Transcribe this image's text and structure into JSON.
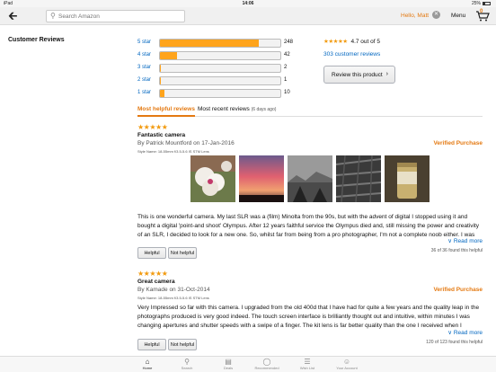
{
  "status": {
    "device": "iPad",
    "time": "14:06",
    "battery": "25%"
  },
  "header": {
    "search_placeholder": "Search Amazon",
    "greeting": "Hello, Matt",
    "menu_label": "Menu",
    "cart_count": "0"
  },
  "page": {
    "section_title": "Customer Reviews"
  },
  "histogram": [
    {
      "label": "5 star",
      "count": "248",
      "fraction": 0.82
    },
    {
      "label": "4 star",
      "count": "42",
      "fraction": 0.14
    },
    {
      "label": "3 star",
      "count": "2",
      "fraction": 0.01
    },
    {
      "label": "2 star",
      "count": "1",
      "fraction": 0.005
    },
    {
      "label": "1 star",
      "count": "10",
      "fraction": 0.035
    }
  ],
  "summary": {
    "stars": "★★★★★",
    "rating_text": "4.7 out of 5",
    "reviews_link": "303 customer reviews",
    "write_button": "Review this product"
  },
  "tabs": {
    "helpful": "Most helpful reviews",
    "recent": "Most recent reviews",
    "recent_note": "(6 days ago)"
  },
  "reviews": [
    {
      "stars": "★★★★★",
      "title": "Fantastic camera",
      "by_prefix": "By",
      "author": "Patrick Mountford",
      "date": "on 17-Jan-2016",
      "verified": "Verified Purchase",
      "style": "Style Name: 18-55mm f/3.5-5.6 IS STM Lens",
      "body": "This is one wonderful camera. My last SLR was a (film) Minolta from the 90s, but with the advent of digital I stopped using it and bought a digital 'point-and shoot' Olympus. After 12 years faithful service the Olympus died and, still missing the power and creativity of an SLR, I decided to look for a new one. So, whilst far from being from a pro photographer, I'm not a complete noob either. I was looking for something",
      "more": "Read more",
      "found": "36 of 36 found this helpful",
      "helpful_btn": "Helpful",
      "not_helpful_btn": "Not helpful"
    },
    {
      "stars": "★★★★★",
      "title": "Great camera",
      "by_prefix": "By",
      "author": "Kamade",
      "date": "on 31-Oct-2014",
      "verified": "Verified Purchase",
      "style": "Style Name: 18-55mm f/3.5-5.6 IS STM Lens",
      "body": "Very Impressed so far with this camera. I upgraded from the old 400d that I have had for quite a few years and the quality leap in the photographs produced is very good indeed. The touch screen interface is brilliantly thought out and intuitive, within minutes I was changing apertures and shutter speeds with a swipe of a finger. The kit lens is far better quality than the one I received when I originally purchased the",
      "more": "Read more",
      "found": "120 of 123 found this helpful",
      "helpful_btn": "Helpful",
      "not_helpful_btn": "Not helpful"
    }
  ],
  "tabbar": [
    {
      "label": "Home",
      "icon": "home-icon"
    },
    {
      "label": "Search",
      "icon": "search-icon"
    },
    {
      "label": "Deals",
      "icon": "deals-icon"
    },
    {
      "label": "Recommended",
      "icon": "recommended-icon"
    },
    {
      "label": "Wish List",
      "icon": "wishlist-icon"
    },
    {
      "label": "Your Account",
      "icon": "account-icon"
    }
  ],
  "colors": {
    "accent": "#e47911",
    "link": "#0066c0",
    "bar_fill": "#ffa41c",
    "star": "#f29a0e"
  }
}
